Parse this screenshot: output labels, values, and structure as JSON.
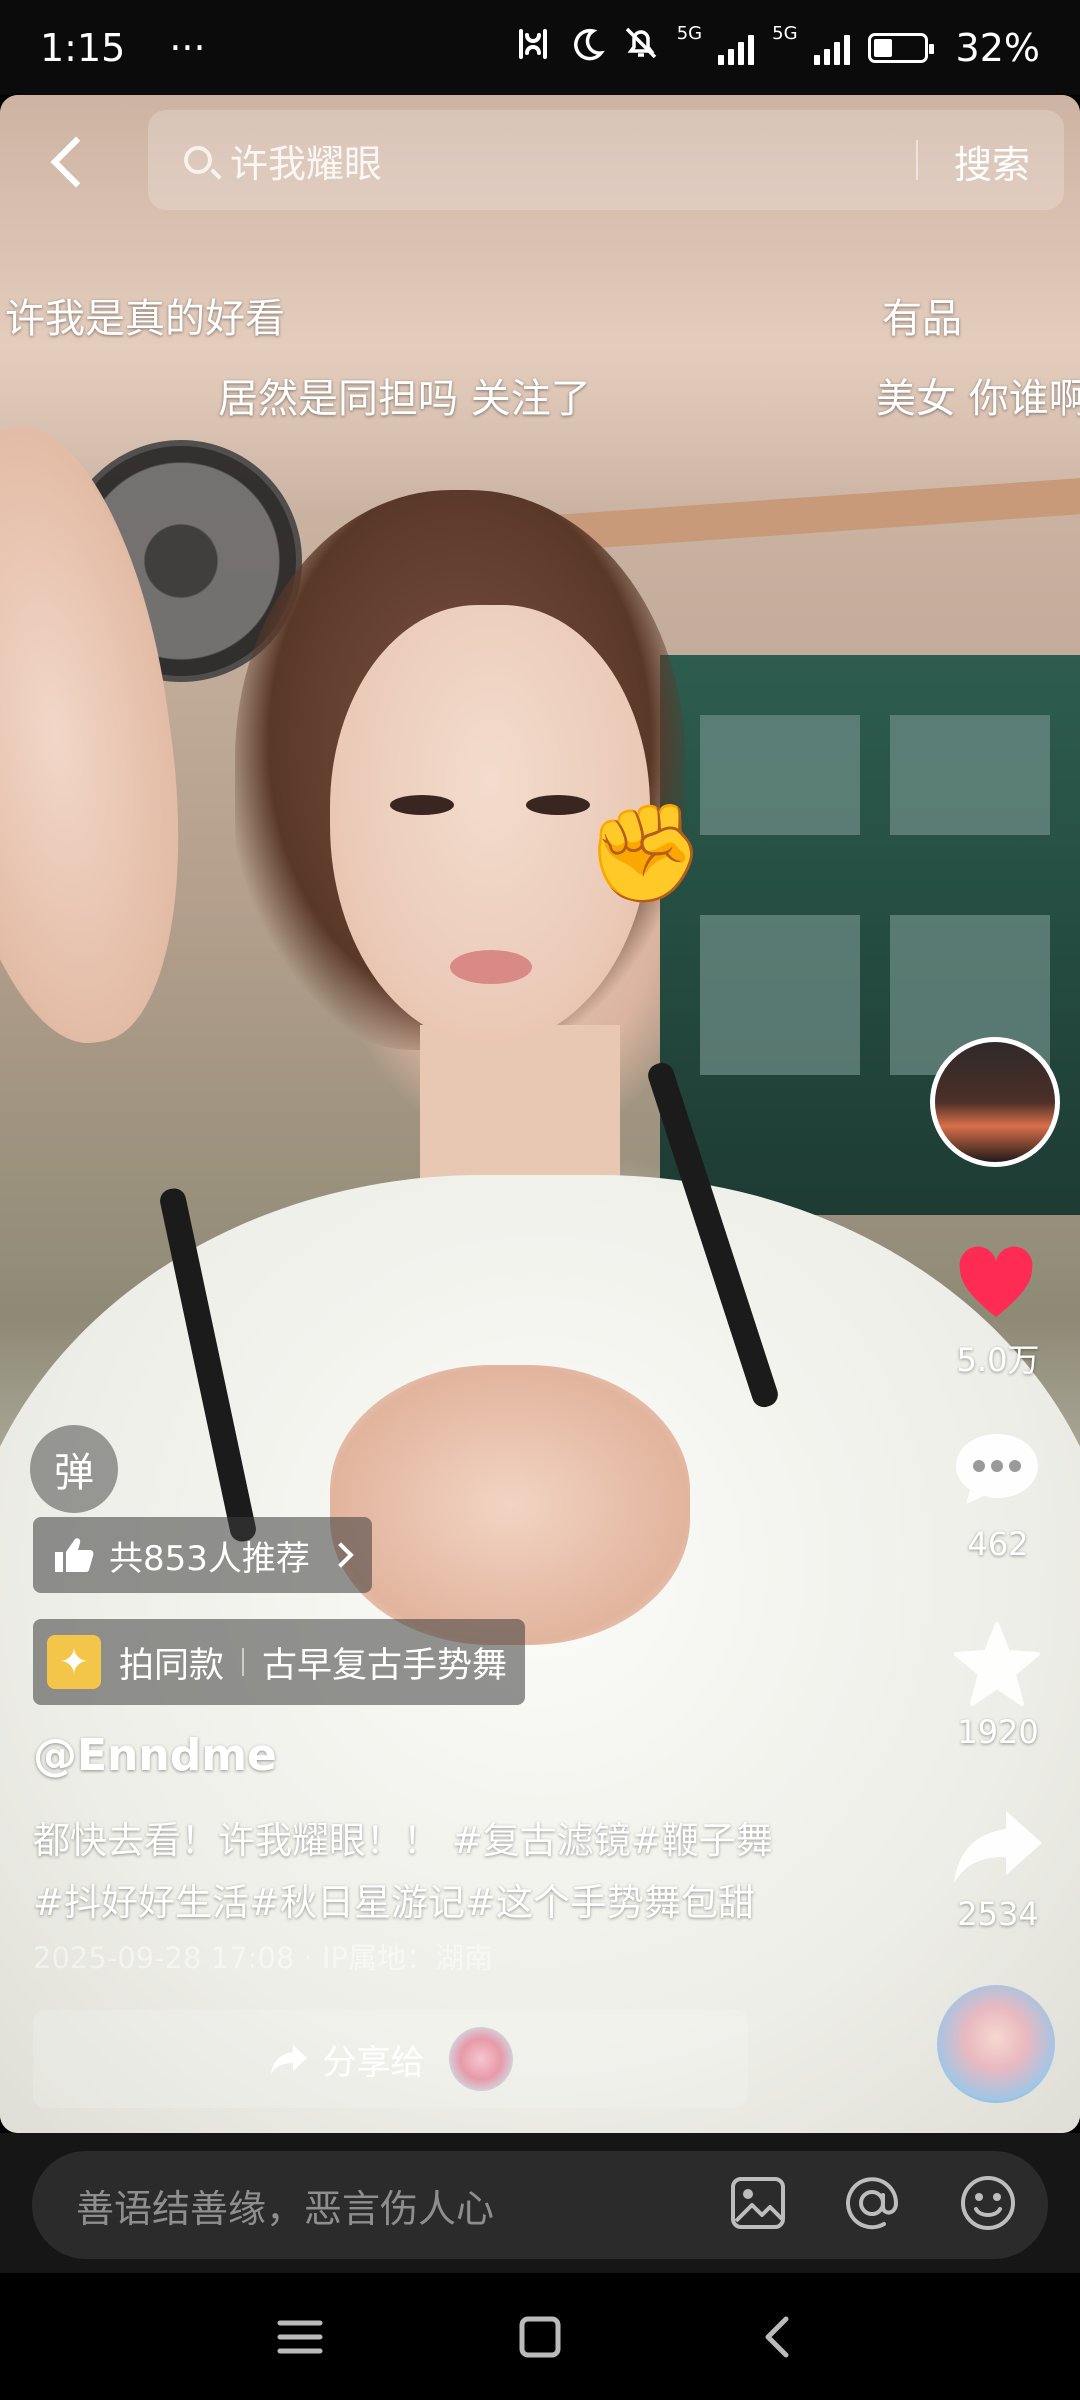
{
  "status_bar": {
    "time": "1:15",
    "dots": "···",
    "net_label_1": "5G",
    "net_label_2": "5G",
    "battery": "32%"
  },
  "search": {
    "query": "许我耀眼",
    "button": "搜索"
  },
  "danmaku": [
    "许我是真的好看",
    "有品",
    "居然是同担吗 关注了",
    "美女 你谁啊"
  ],
  "sidebar": {
    "likes": "5.0万",
    "comments": "462",
    "favorites": "1920",
    "shares": "2534"
  },
  "overlay": {
    "danmaku_toggle": "弹",
    "recommend": "共853人推荐",
    "sameclip_label": "拍同款",
    "sameclip_title": "古早复古手势舞"
  },
  "post": {
    "author": "@Enndme",
    "caption_line1": "都快去看！许我耀眼！！ #复古滤镜#鞭子舞",
    "caption_line2": "#抖好好生活#秋日星游记#这个手势舞包甜",
    "meta": "2025-09-28 17:08 · IP属地：湖南"
  },
  "share_bar": {
    "label": "分享给"
  },
  "comment": {
    "placeholder": "善语结善缘，恶言伤人心"
  },
  "colors": {
    "like": "#fe2c55",
    "sparkle": "#f3c64a"
  },
  "icons": [
    "back-icon",
    "search-icon",
    "heart-icon",
    "comment-icon",
    "star-icon",
    "share-icon",
    "image-icon",
    "at-icon",
    "emoji-icon",
    "menu-icon",
    "home-icon",
    "back-nav-icon"
  ]
}
